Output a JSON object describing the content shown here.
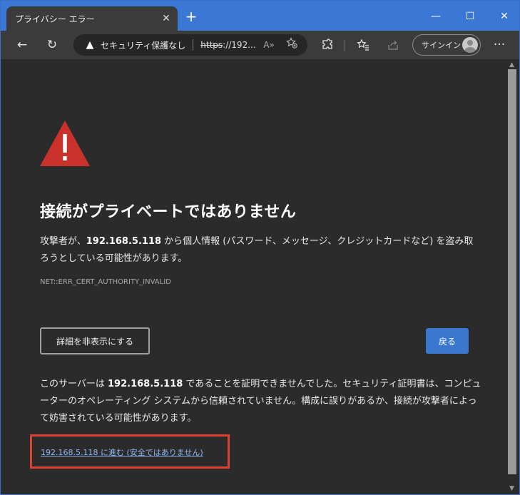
{
  "tab": {
    "title": "プライバシー エラー",
    "close": "✕",
    "new_tab": "+"
  },
  "window_controls": {
    "minimize": "—",
    "maximize": "☐",
    "close": "✕"
  },
  "toolbar": {
    "back": "←",
    "refresh": "↻",
    "security_label": "セキュリティ保護なし",
    "url_scheme": "https",
    "url_rest": "://192...",
    "read_aloud": "A»",
    "signin_label": "サインイン",
    "more": "···"
  },
  "page": {
    "heading": "接続がプライベートではありません",
    "desc_prefix": "攻撃者が、",
    "host": "192.168.5.118",
    "desc_suffix": " から個人情報 (パスワード、メッセージ、クレジットカードなど) を盗み取ろうとしている可能性があります。",
    "error_code": "NET::ERR_CERT_AUTHORITY_INVALID",
    "hide_details_button": "詳細を非表示にする",
    "back_button": "戻る",
    "detail_prefix": "このサーバーは ",
    "detail_suffix": " であることを証明できませんでした。セキュリティ証明書は、コンピューターのオペレーティング システムから信頼されていません。構成に誤りがあるか、接続が攻撃者によって妨害されている可能性があります。",
    "proceed_link": "192.168.5.118 に進む (安全ではありません)"
  },
  "colors": {
    "titlebar": "#3b78d6",
    "warning_red": "#c8322a",
    "primary_button": "#3a78cf",
    "highlight_box": "#e0402f",
    "link": "#8db7ef"
  }
}
